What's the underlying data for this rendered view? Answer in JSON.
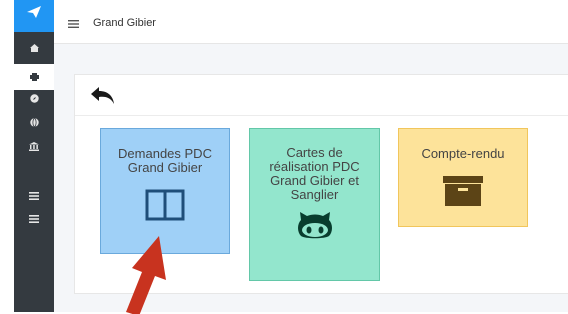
{
  "app": {
    "title": "Grand Gibier",
    "colors": {
      "sidebar": "#343a40",
      "logo": "#2196f3",
      "accent_arrow": "#c8331f"
    }
  },
  "sidebar": {
    "items": [
      {
        "icon": "home-icon"
      },
      {
        "icon": "print-icon",
        "active": true
      },
      {
        "icon": "compass-icon"
      },
      {
        "icon": "globe-icon"
      },
      {
        "icon": "bank-icon"
      },
      {
        "icon": "list-icon"
      },
      {
        "icon": "list-icon"
      }
    ]
  },
  "toolbar": {
    "back_icon": "undo-icon"
  },
  "cards": [
    {
      "label": "Demandes PDC Grand Gibier",
      "icon": "columns-icon",
      "color": "#9fd0f7"
    },
    {
      "label": "Cartes de réalisation PDC Grand Gibier et Sanglier",
      "icon": "github-icon",
      "color": "#93e6cd"
    },
    {
      "label": "Compte-rendu",
      "icon": "archive-icon",
      "color": "#fde39a"
    }
  ],
  "annotation": {
    "icon": "pointer-arrow-icon"
  }
}
